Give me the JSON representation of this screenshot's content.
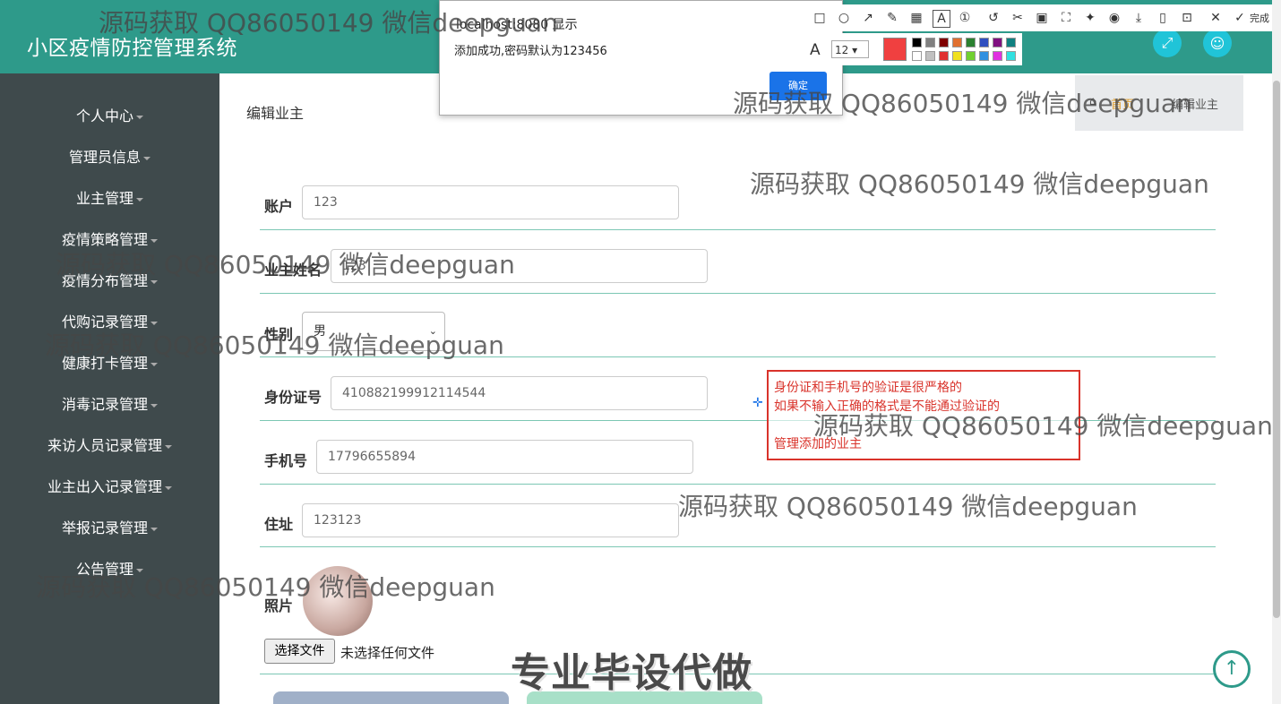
{
  "header": {
    "title": "小区疫情防控管理系统",
    "icons": [
      "fullscreen-icon",
      "user-icon"
    ],
    "color": "#2e9a8a"
  },
  "sidebar": {
    "items": [
      {
        "label": "个人中心"
      },
      {
        "label": "管理员信息"
      },
      {
        "label": "业主管理"
      },
      {
        "label": "疫情策略管理"
      },
      {
        "label": "疫情分布管理"
      },
      {
        "label": "代购记录管理"
      },
      {
        "label": "健康打卡管理"
      },
      {
        "label": "消毒记录管理"
      },
      {
        "label": "来访人员记录管理"
      },
      {
        "label": "业主出入记录管理"
      },
      {
        "label": "举报记录管理"
      },
      {
        "label": "公告管理"
      }
    ]
  },
  "page": {
    "title": "编辑业主",
    "breadcrumb": {
      "home": "首页",
      "current": "编辑业主"
    }
  },
  "form": {
    "account": {
      "label": "账户",
      "value": "123"
    },
    "name": {
      "label": "业主姓名",
      "value": "123"
    },
    "gender": {
      "label": "性别",
      "value": "男"
    },
    "id_number": {
      "label": "身份证号",
      "value": "410882199912114544"
    },
    "phone": {
      "label": "手机号",
      "value": "17796655894"
    },
    "address": {
      "label": "住址",
      "value": "123123"
    },
    "photo": {
      "label": "照片",
      "button": "选择文件",
      "status": "未选择任何文件"
    }
  },
  "dialog": {
    "title": "localhost:8080 显示",
    "message": "添加成功,密码默认为123456",
    "ok": "确定"
  },
  "screenshot_tool": {
    "font_size": "12",
    "done": "完成",
    "accent": "#f04040"
  },
  "annotation": {
    "lines": [
      "身份证和手机号的验证是很严格的",
      "如果不输入正确的格式是不能通过验证的",
      "管理添加的业主"
    ],
    "color": "#d9332b"
  },
  "watermarks": {
    "text": "源码获取 QQ86050149 微信deepguan",
    "promo": "专业毕设代做"
  }
}
